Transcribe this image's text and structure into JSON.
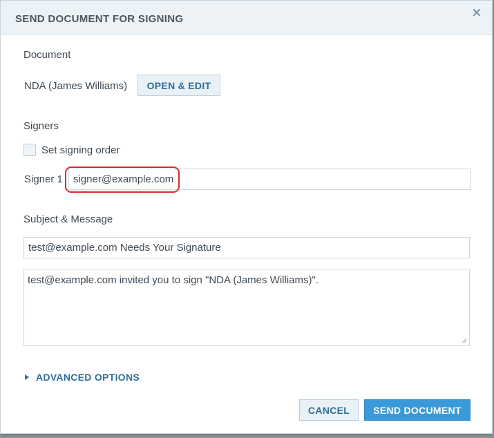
{
  "dialog": {
    "title": "SEND DOCUMENT FOR SIGNING",
    "close_icon": "close-icon"
  },
  "document_section": {
    "label": "Document",
    "document_name": "NDA (James Williams)",
    "open_edit_label": "OPEN & EDIT"
  },
  "signers_section": {
    "label": "Signers",
    "signing_order_label": "Set signing order",
    "signing_order_checked": false,
    "signer_label": "Signer 1",
    "signer_value": "signer@example.com"
  },
  "message_section": {
    "label": "Subject & Message",
    "subject_value": "test@example.com Needs Your Signature",
    "message_value": "test@example.com invited you to sign \"NDA (James Williams)\"."
  },
  "advanced_options": {
    "label": "ADVANCED OPTIONS",
    "icon": "caret-right-icon",
    "expanded": false
  },
  "footer": {
    "cancel_label": "CANCEL",
    "send_label": "SEND DOCUMENT"
  },
  "colors": {
    "accent": "#3a9ad9",
    "link": "#2e6e98",
    "highlight": "#d82b2b",
    "header_bg": "#ecf2f6"
  }
}
